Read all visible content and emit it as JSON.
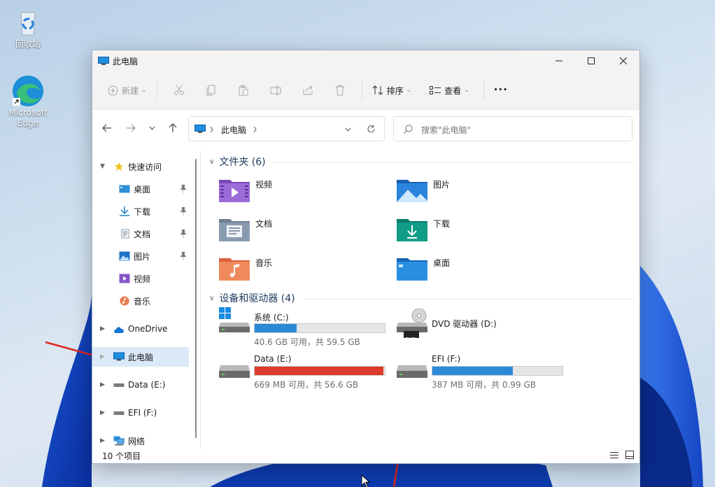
{
  "desktop": {
    "icons": [
      {
        "label": "回收站"
      },
      {
        "label": "Microsoft Edge"
      }
    ]
  },
  "window": {
    "title": "此电脑",
    "controls": {
      "minimize": "─",
      "maximize": "☐",
      "close": "✕"
    }
  },
  "toolbar": {
    "new_label": "新建",
    "sort_label": "排序",
    "view_label": "查看",
    "more": "•••"
  },
  "address": {
    "path": "此电脑",
    "search_placeholder": "搜索\"此电脑\""
  },
  "nav": {
    "quick_access": "快速访问",
    "items": [
      {
        "label": "桌面"
      },
      {
        "label": "下载"
      },
      {
        "label": "文档"
      },
      {
        "label": "图片"
      },
      {
        "label": "视频"
      },
      {
        "label": "音乐"
      }
    ],
    "onedrive": "OneDrive",
    "this_pc": "此电脑",
    "data_drive": "Data (E:)",
    "efi_drive": "EFI (F:)",
    "network": "网络"
  },
  "content": {
    "folders_header": "文件夹 (6)",
    "folders": [
      {
        "label": "视频"
      },
      {
        "label": "图片"
      },
      {
        "label": "文档"
      },
      {
        "label": "下载"
      },
      {
        "label": "音乐"
      },
      {
        "label": "桌面"
      }
    ],
    "drives_header": "设备和驱动器 (4)",
    "drives": [
      {
        "name": "系统 (C:)",
        "info": "40.6 GB 可用，共 59.5 GB",
        "used_fraction": 0.32,
        "color": "#2a8ad8"
      },
      {
        "name": "DVD 驱动器 (D:)",
        "info": "",
        "used_fraction": null,
        "color": ""
      },
      {
        "name": "Data (E:)",
        "info": "669 MB 可用，共 56.6 GB",
        "used_fraction": 0.99,
        "color": "#da3b2a"
      },
      {
        "name": "EFI (F:)",
        "info": "387 MB 可用，共 0.99 GB",
        "used_fraction": 0.62,
        "color": "#2a8ad8"
      }
    ],
    "dvd_label": "DVD"
  },
  "status": {
    "count": "10 个项目"
  }
}
